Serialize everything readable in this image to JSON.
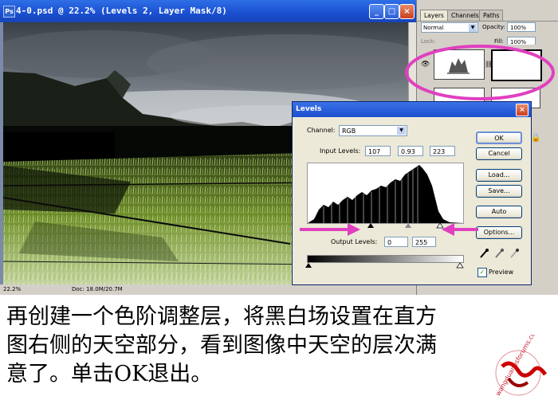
{
  "document": {
    "title": "4-0.psd @ 22.2% (Levels 2, Layer Mask/8)",
    "status_zoom": "22.2%",
    "status_doc": "Doc: 18.0M/20.7M"
  },
  "layers_panel": {
    "tabs": [
      "Layers",
      "Channels",
      "Paths"
    ],
    "blend_mode": "Normal",
    "opacity_label": "Opacity:",
    "opacity_value": "100%",
    "lock_label": "Lock:",
    "fill_label": "Fill:",
    "fill_value": "100%"
  },
  "levels_dialog": {
    "title": "Levels",
    "channel_label": "Channel:",
    "channel_value": "RGB",
    "input_levels_label": "Input Levels:",
    "input_black": "107",
    "input_gamma": "0.93",
    "input_white": "223",
    "output_levels_label": "Output Levels:",
    "output_black": "0",
    "output_white": "255",
    "buttons": {
      "ok": "OK",
      "cancel": "Cancel",
      "load": "Load...",
      "save": "Save...",
      "auto": "Auto",
      "options": "Options..."
    },
    "preview_label": "Preview",
    "preview_checked": true
  },
  "caption": {
    "line1": "再创建一个色阶调整层，将黑白场设置在直方",
    "line2": "图右侧的天空部分，看到图像中天空的层次满",
    "line3": "意了。单击OK退出。"
  },
  "watermark": {
    "url": "wangduanpsforums.com"
  },
  "colors": {
    "highlight_circle": "#e040c0",
    "arrow": "#e040c0",
    "title_blue": "#1e4fcf"
  }
}
